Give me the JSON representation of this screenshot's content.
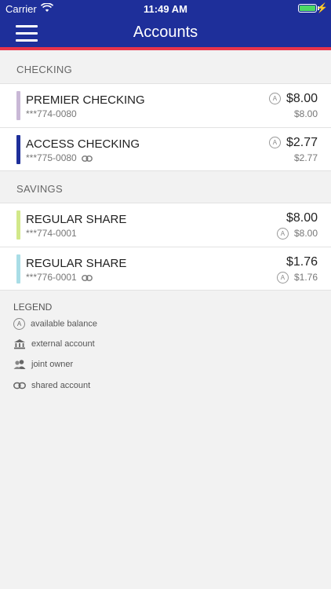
{
  "status_bar": {
    "carrier": "Carrier",
    "time": "11:49 AM"
  },
  "header": {
    "title": "Accounts"
  },
  "sections": {
    "checking": {
      "label": "CHECKING"
    },
    "savings": {
      "label": "SAVINGS"
    }
  },
  "accounts": [
    {
      "name": "PREMIER CHECKING",
      "number": "***774-0080",
      "primary": "$8.00",
      "secondary": "$8.00",
      "color": "#c9b8d6"
    },
    {
      "name": "ACCESS CHECKING",
      "number": "***775-0080",
      "primary": "$2.77",
      "secondary": "$2.77",
      "color": "#1e2f9a"
    },
    {
      "name": "REGULAR SHARE",
      "number": "***774-0001",
      "primary": "$8.00",
      "secondary": "$8.00",
      "color": "#d2e88a"
    },
    {
      "name": "REGULAR SHARE",
      "number": "***776-0001",
      "primary": "$1.76",
      "secondary": "$1.76",
      "color": "#a9dde6"
    }
  ],
  "legend": {
    "title": "LEGEND",
    "items": [
      {
        "label": "available balance",
        "icon": "available-balance-icon"
      },
      {
        "label": "external account",
        "icon": "bank-icon"
      },
      {
        "label": "joint owner",
        "icon": "joint-owner-icon"
      },
      {
        "label": "shared account",
        "icon": "link-icon"
      }
    ],
    "badge": "A"
  },
  "colors": {
    "header": "#1e2f9a",
    "accent_line": "#e8344a"
  }
}
